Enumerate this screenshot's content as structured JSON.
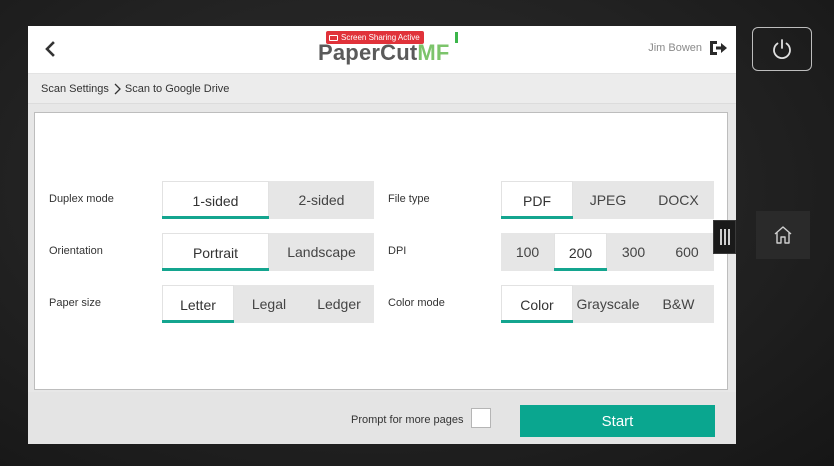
{
  "header": {
    "logo_primary": "PaperCut",
    "logo_accent": "MF",
    "screen_sharing_badge": "Screen Sharing Active",
    "user_name": "Jim Bowen",
    "icons": {
      "back": "chevron-left-icon",
      "logout": "logout-icon",
      "sharing": "monitor-icon"
    }
  },
  "breadcrumb": {
    "items": [
      {
        "label": "Scan Settings"
      },
      {
        "label": "Scan to Google Drive"
      }
    ],
    "separator_icon": "chevron-right-icon"
  },
  "settings": {
    "duplex_mode": {
      "label": "Duplex mode",
      "options": [
        "1-sided",
        "2-sided"
      ],
      "selected": "1-sided"
    },
    "orientation": {
      "label": "Orientation",
      "options": [
        "Portrait",
        "Landscape"
      ],
      "selected": "Portrait"
    },
    "paper_size": {
      "label": "Paper size",
      "options": [
        "Letter",
        "Legal",
        "Ledger"
      ],
      "selected": "Letter"
    },
    "file_type": {
      "label": "File type",
      "options": [
        "PDF",
        "JPEG",
        "DOCX"
      ],
      "selected": "PDF"
    },
    "dpi": {
      "label": "DPI",
      "options": [
        "100",
        "200",
        "300",
        "600"
      ],
      "selected": "200"
    },
    "color_mode": {
      "label": "Color mode",
      "options": [
        "Color",
        "Grayscale",
        "B&W"
      ],
      "selected": "Color"
    }
  },
  "footer": {
    "prompt_label": "Prompt for more pages",
    "prompt_checked": false,
    "start_label": "Start"
  },
  "device": {
    "power_icon": "power-icon",
    "home_icon": "home-icon",
    "handle_icon": "grip-icon"
  },
  "colors": {
    "accent": "#0aa68f",
    "badge": "#e0323a",
    "logo_accent": "#7cc46b"
  }
}
